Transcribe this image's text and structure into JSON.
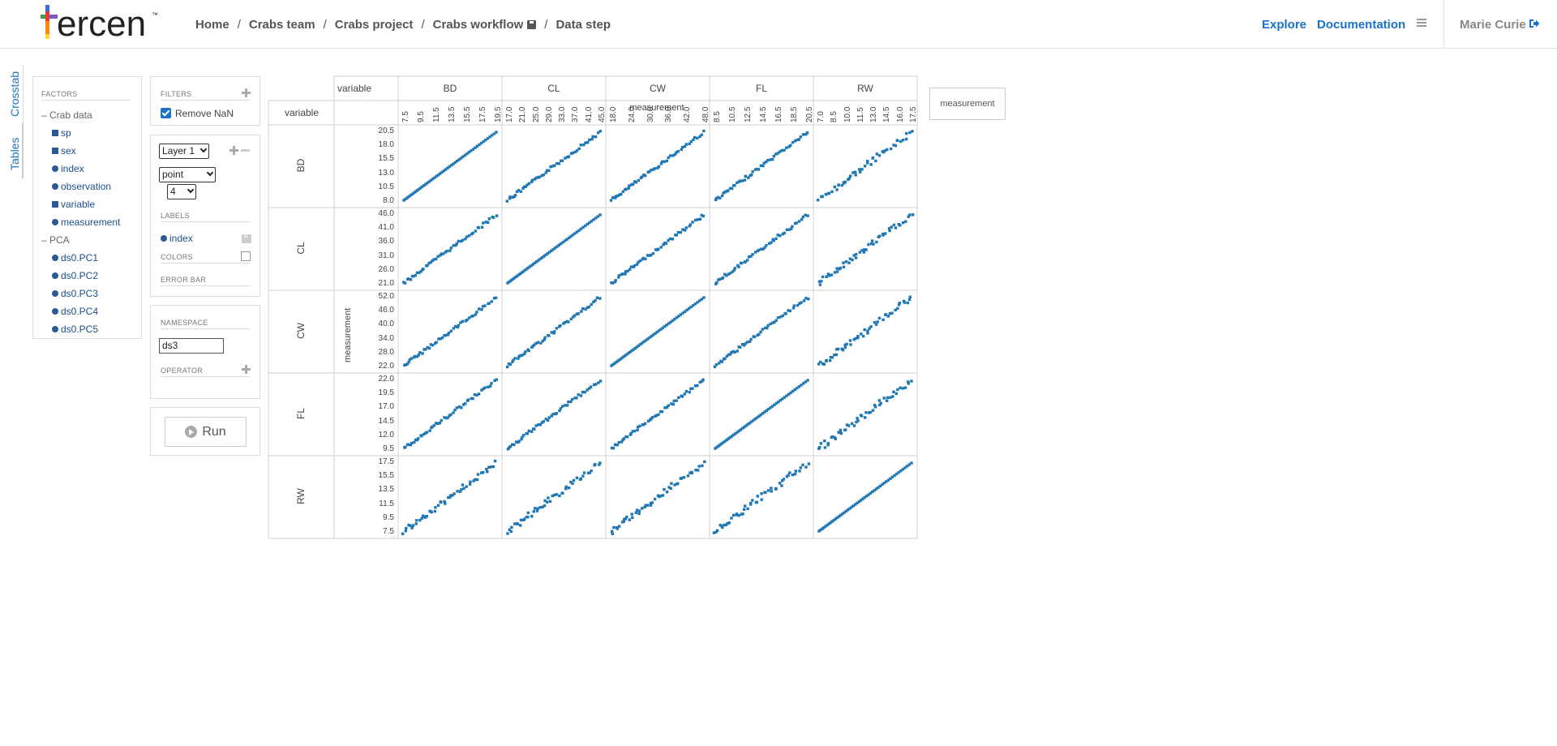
{
  "app": {
    "logo_text": "ercen",
    "logo_tm": "™"
  },
  "breadcrumb": [
    "Home",
    "Crabs team",
    "Crabs project",
    "Crabs workflow",
    "Data step"
  ],
  "nav": {
    "explore": "Explore",
    "documentation": "Documentation",
    "user": "Marie Curie"
  },
  "vertical_tabs": {
    "crosstab": "Crosstab",
    "tables": "Tables"
  },
  "factors": {
    "title": "FACTORS",
    "groups": [
      {
        "label": "Crab data",
        "items": [
          {
            "label": "sp",
            "kind": "square"
          },
          {
            "label": "sex",
            "kind": "square"
          },
          {
            "label": "index",
            "kind": "dot"
          },
          {
            "label": "observation",
            "kind": "dot"
          },
          {
            "label": "variable",
            "kind": "square"
          },
          {
            "label": "measurement",
            "kind": "dot"
          }
        ]
      },
      {
        "label": "PCA",
        "items": [
          {
            "label": "ds0.PC1",
            "kind": "dot"
          },
          {
            "label": "ds0.PC2",
            "kind": "dot"
          },
          {
            "label": "ds0.PC3",
            "kind": "dot"
          },
          {
            "label": "ds0.PC4",
            "kind": "dot"
          },
          {
            "label": "ds0.PC5",
            "kind": "dot"
          }
        ]
      }
    ]
  },
  "filters": {
    "title": "FILTERS",
    "remove_nan": "Remove NaN",
    "remove_nan_checked": true
  },
  "layers": {
    "layer_select": "Layer 1",
    "geom_select": "point",
    "size_select": "4",
    "labels_title": "LABELS",
    "label_item": "index",
    "colors_title": "COLORS",
    "errorbar_title": "ERROR BAR"
  },
  "namespace": {
    "title": "NAMESPACE",
    "value": "ds3",
    "operator_title": "OPERATOR"
  },
  "run": {
    "label": "Run"
  },
  "crosstab": {
    "col_header_title": "variable",
    "row_header_title": "variable",
    "x_axis_title": "measurement",
    "y_axis_title": "measurement",
    "legend_label": "measurement",
    "columns": [
      "BD",
      "CL",
      "CW",
      "FL",
      "RW"
    ],
    "rows": [
      "BD",
      "CL",
      "CW",
      "FL",
      "RW"
    ],
    "x_ticks": [
      [
        "7.5",
        "9.5",
        "11.5",
        "13.5",
        "15.5",
        "17.5",
        "19.5"
      ],
      [
        "17.0",
        "21.0",
        "25.0",
        "29.0",
        "33.0",
        "37.0",
        "41.0",
        "45.0"
      ],
      [
        "18.0",
        "24.0",
        "30.0",
        "36.0",
        "42.0",
        "48.0"
      ],
      [
        "8.5",
        "10.5",
        "12.5",
        "14.5",
        "16.5",
        "18.5",
        "20.5"
      ],
      [
        "7.0",
        "8.5",
        "10.0",
        "11.5",
        "13.0",
        "14.5",
        "16.0",
        "17.5"
      ]
    ],
    "y_ticks": [
      [
        "20.5",
        "18.0",
        "15.5",
        "13.0",
        "10.5",
        "8.0"
      ],
      [
        "46.0",
        "41.0",
        "36.0",
        "31.0",
        "26.0",
        "21.0"
      ],
      [
        "52.0",
        "46.0",
        "40.0",
        "34.0",
        "28.0",
        "22.0"
      ],
      [
        "22.0",
        "19.5",
        "17.0",
        "14.5",
        "12.0",
        "9.5"
      ],
      [
        "17.5",
        "15.5",
        "13.5",
        "11.5",
        "9.5",
        "7.5"
      ]
    ],
    "point_color": "#1f77b4"
  }
}
